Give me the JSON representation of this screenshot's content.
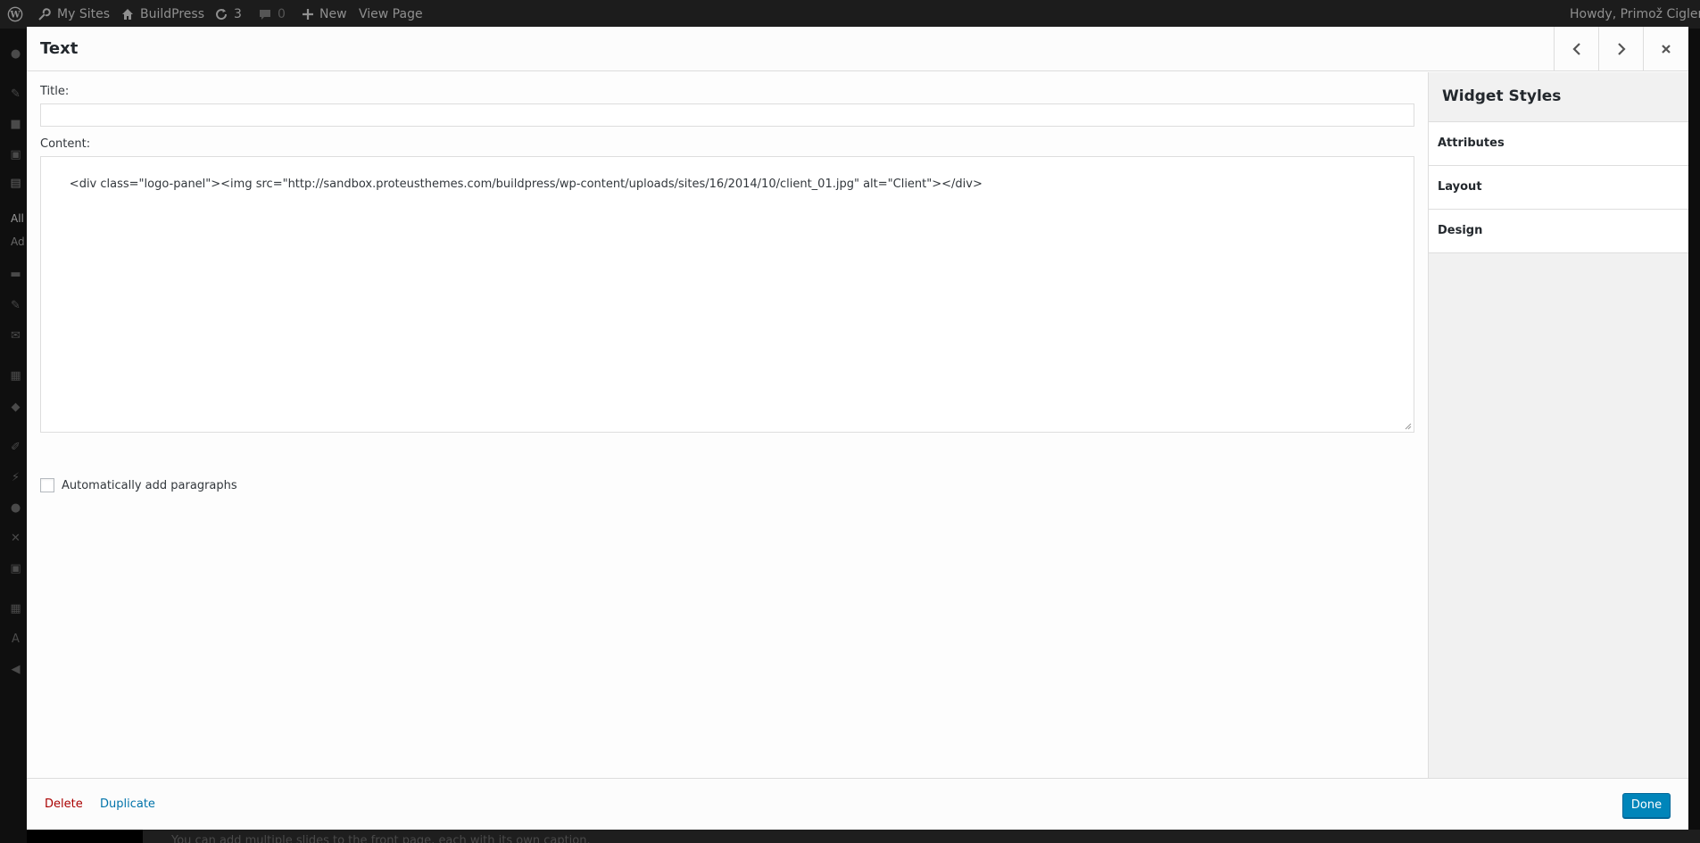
{
  "admin_bar": {
    "my_sites": "My Sites",
    "site_name": "BuildPress",
    "updates_count": "3",
    "comments_count": "0",
    "new_label": "New",
    "view_page": "View Page",
    "howdy": "Howdy, Primož Cigler"
  },
  "admin_menu": {
    "all_label": "All",
    "add_label": "Ad"
  },
  "background": {
    "page_text": "You can add multiple slides to the front page, each with its own caption."
  },
  "modal": {
    "title": "Text",
    "prev_icon": "chevron-left-icon",
    "next_icon": "chevron-right-icon",
    "close_icon": "close-icon",
    "fields": {
      "title_label": "Title:",
      "title_value": "",
      "content_label": "Content:",
      "content_value": "<div class=\"logo-panel\"><img src=\"http://sandbox.proteusthemes.com/buildpress/wp-content/uploads/sites/16/2014/10/client_01.jpg\" alt=\"Client\"></div>",
      "autop_label": "Automatically add paragraphs",
      "autop_checked": false
    },
    "sidebar": {
      "title": "Widget Styles",
      "sections": [
        "Attributes",
        "Layout",
        "Design"
      ]
    },
    "footer": {
      "delete_label": "Delete",
      "duplicate_label": "Duplicate",
      "done_label": "Done"
    }
  },
  "colors": {
    "admin_bar_bg": "#1c1c1c",
    "primary_button": "#0085ba",
    "link_blue": "#0073aa",
    "delete_red": "#aa0000"
  }
}
